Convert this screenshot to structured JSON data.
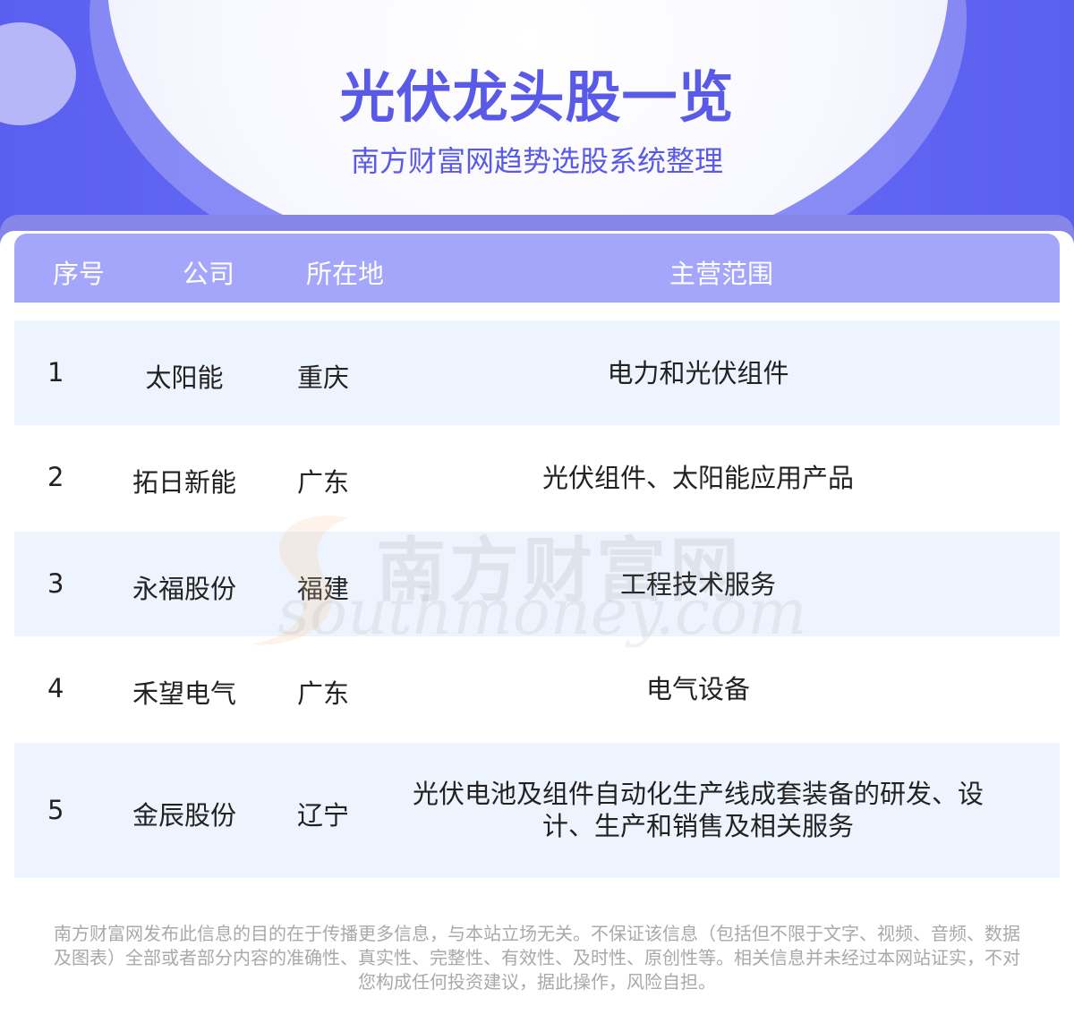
{
  "header": {
    "title": "光伏龙头股一览",
    "subtitle": "南方财富网趋势选股系统整理"
  },
  "table": {
    "columns": [
      "序号",
      "公司",
      "所在地",
      "主营范围"
    ],
    "rows": [
      {
        "index": "1",
        "company": "太阳能",
        "location": "重庆",
        "business": "电力和光伏组件"
      },
      {
        "index": "2",
        "company": "拓日新能",
        "location": "广东",
        "business": "光伏组件、太阳能应用产品"
      },
      {
        "index": "3",
        "company": "永福股份",
        "location": "福建",
        "business": "工程技术服务"
      },
      {
        "index": "4",
        "company": "禾望电气",
        "location": "广东",
        "business": "电气设备"
      },
      {
        "index": "5",
        "company": "金辰股份",
        "location": "辽宁",
        "business_line1": "光伏电池及组件自动化生产线成套装备的研发、设",
        "business_line2": "计、生产和销售及相关服务"
      }
    ]
  },
  "watermark": {
    "cn": "南方财富网",
    "en": "southmoney.com"
  },
  "footer": {
    "line1": "南方财富网发布此信息的目的在于传播更多信息，与本站立场无关。不保证该信息（包括但不限于文字、视频、音频、数据",
    "line2": "及图表）全部或者部分内容的准确性、真实性、完整性、有效性、及时性、原创性等。相关信息并未经过本网站证实，不对",
    "line3": "您构成任何投资建议，据此操作，风险自担。"
  },
  "colors": {
    "brand": "#5a5ae8",
    "header_bg": "#6a6df5",
    "table_head": "#a3a6fb",
    "row_shade": "#eef4fd",
    "footer_text": "#a9a9a9"
  }
}
